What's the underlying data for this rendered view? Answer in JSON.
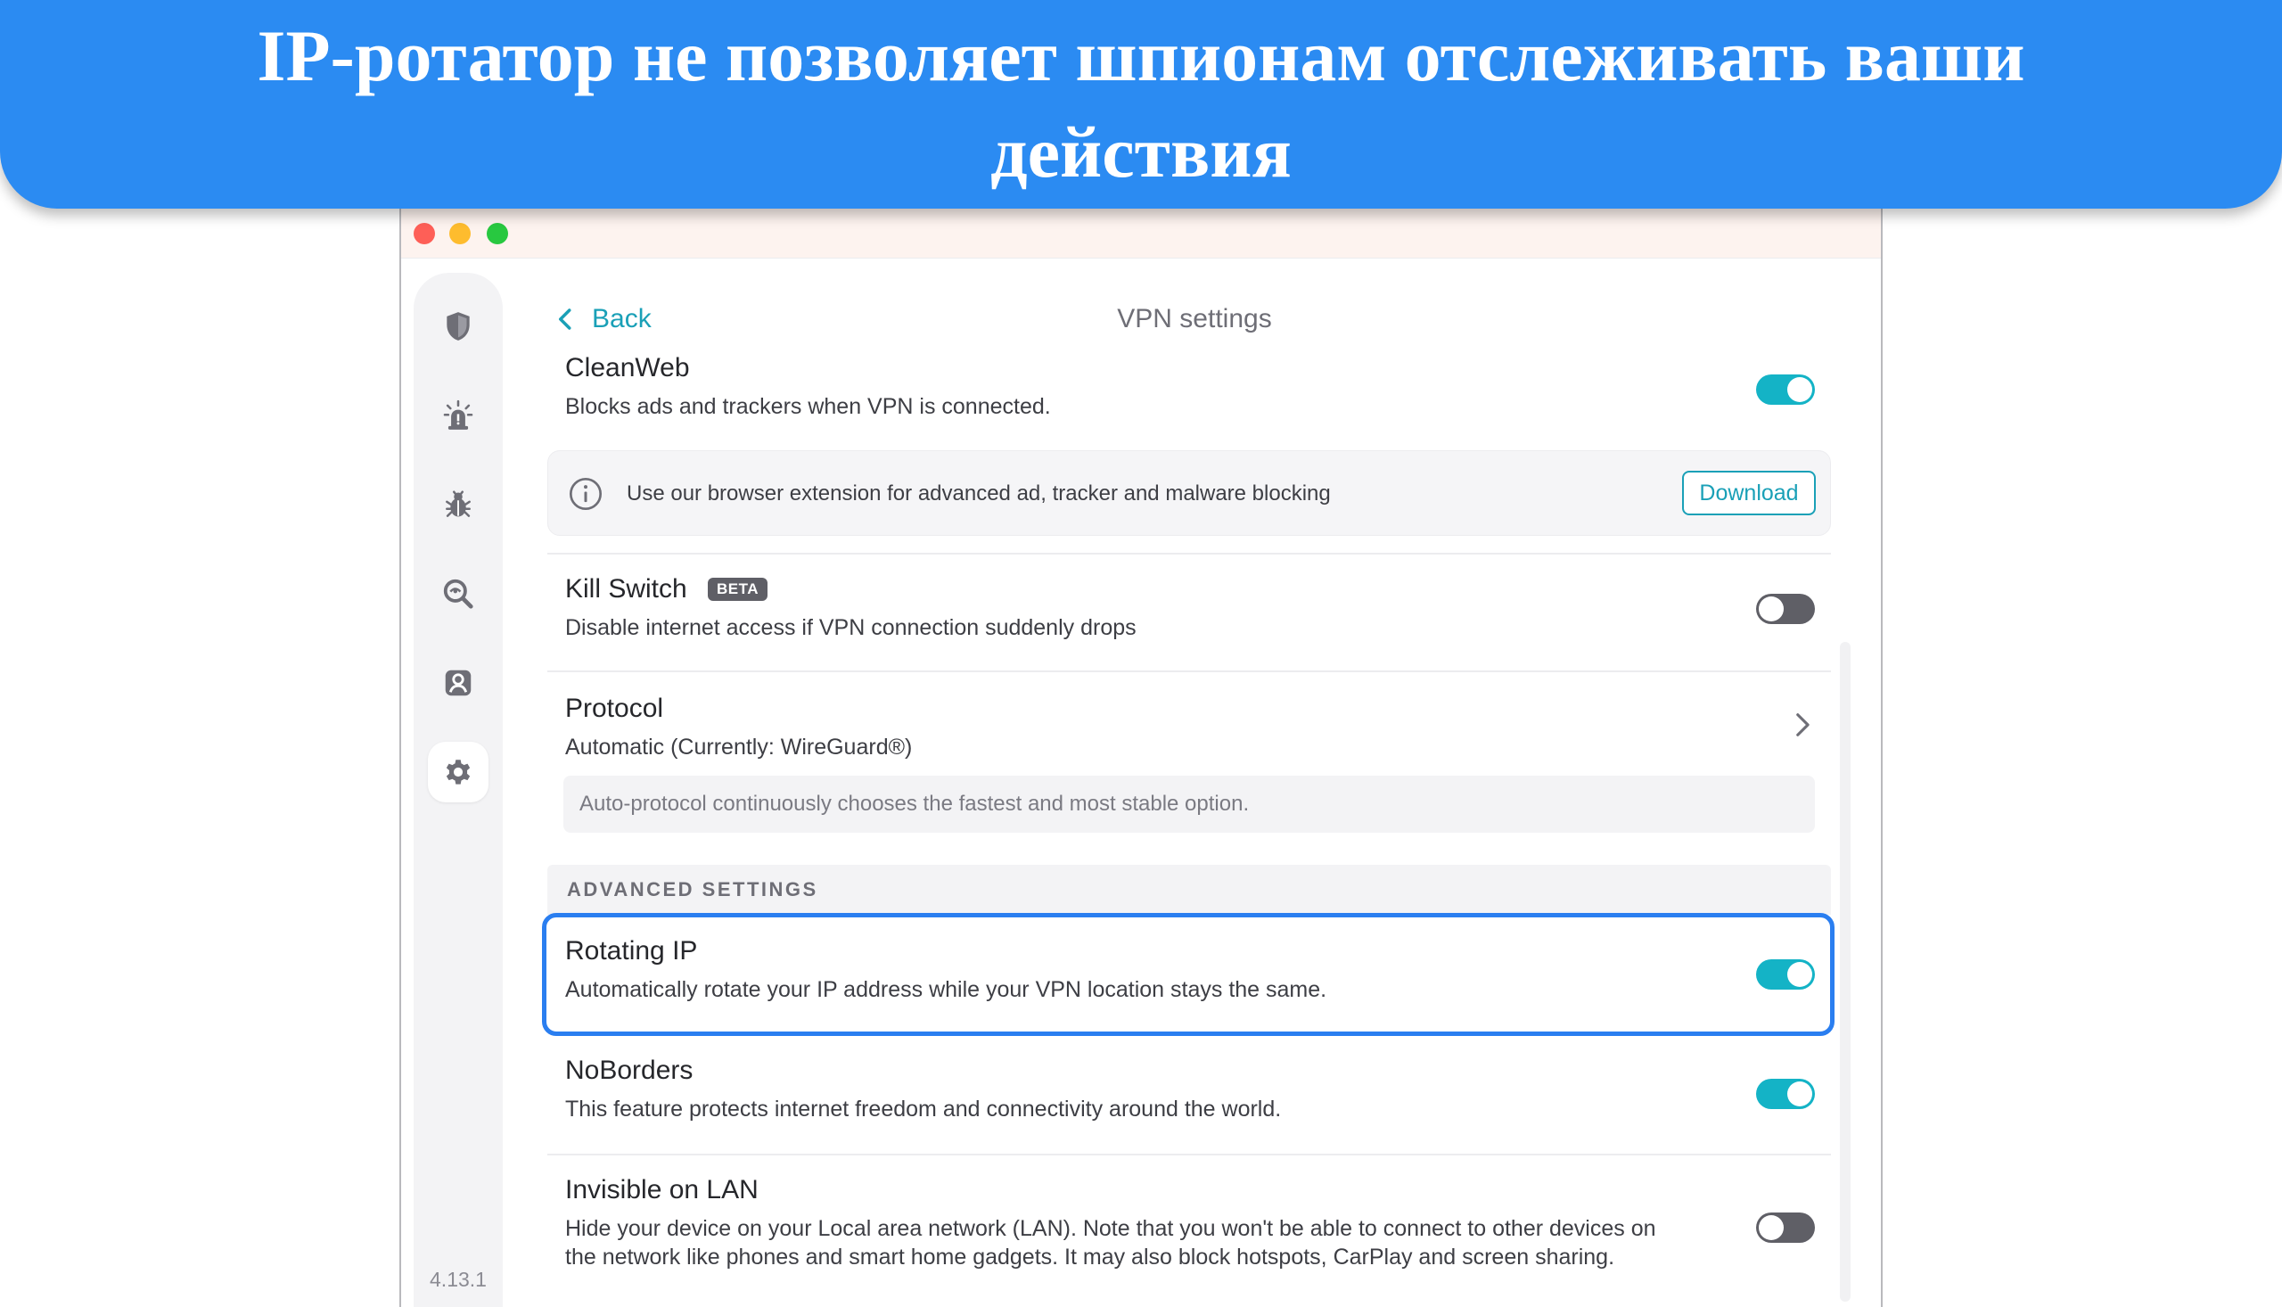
{
  "banner": {
    "title": "IP-ротатор не позволяет шпионам отслеживать ваши действия"
  },
  "window": {
    "traffic_lights": [
      "close",
      "minimize",
      "zoom"
    ]
  },
  "sidebar": {
    "items": [
      {
        "icon": "shield-icon",
        "active": false
      },
      {
        "icon": "alert-icon",
        "active": false
      },
      {
        "icon": "bug-icon",
        "active": false
      },
      {
        "icon": "search-alert-icon",
        "active": false
      },
      {
        "icon": "user-icon",
        "active": false
      },
      {
        "icon": "gear-icon",
        "active": true
      }
    ],
    "version": "4.13.1"
  },
  "header": {
    "back_label": "Back",
    "title": "VPN settings"
  },
  "settings": {
    "cleanweb": {
      "title": "CleanWeb",
      "description": "Blocks ads and trackers when VPN is connected.",
      "enabled": true
    },
    "extension_info": {
      "text": "Use our browser extension for advanced ad, tracker and malware blocking",
      "button_label": "Download"
    },
    "kill_switch": {
      "title": "Kill Switch",
      "badge": "BETA",
      "description": "Disable internet access if VPN connection suddenly drops",
      "enabled": false
    },
    "protocol": {
      "title": "Protocol",
      "description": "Automatic (Currently: WireGuard®)",
      "hint": "Auto-protocol continuously chooses the fastest and most stable option."
    },
    "advanced_header": "ADVANCED SETTINGS",
    "rotating_ip": {
      "title": "Rotating IP",
      "description": "Automatically rotate your IP address while your VPN location stays the same.",
      "enabled": true
    },
    "noborders": {
      "title": "NoBorders",
      "description": "This feature protects internet freedom and connectivity around the world.",
      "enabled": true
    },
    "invisible_lan": {
      "title": "Invisible on LAN",
      "description_line1": "Hide your device on your Local area network (LAN). Note that you won't be able to connect to other devices on",
      "description_line2": "the network like phones and smart home gadgets. It may also block hotspots, CarPlay and screen sharing.",
      "enabled": false
    }
  },
  "colors": {
    "banner": "#2b8bf2",
    "accent": "#14b3c6",
    "link": "#1aa0b7",
    "highlight": "#2a7ef0",
    "toggle_off": "#5f5f66"
  }
}
